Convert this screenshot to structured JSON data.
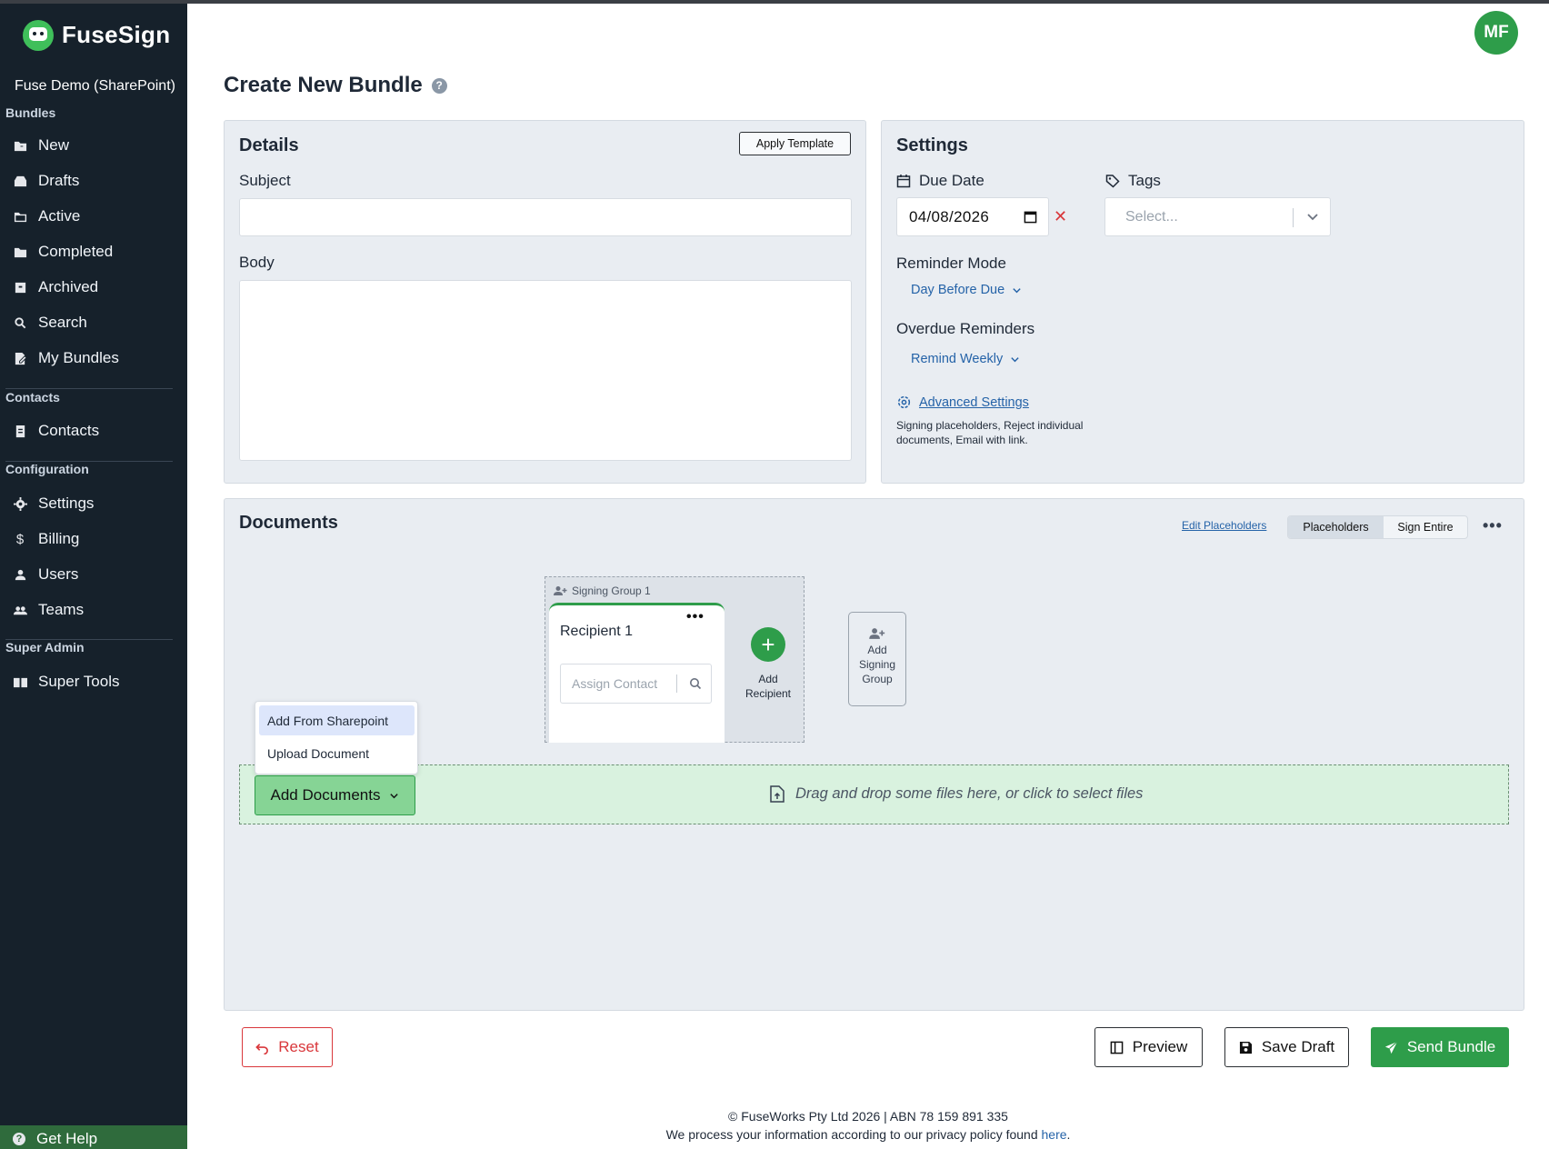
{
  "app": {
    "name": "FuseSign",
    "org": "Fuse Demo (SharePoint)",
    "user_initials": "MF",
    "brand_color": "#2e9d4a"
  },
  "sidebar": {
    "sections": [
      {
        "label": "Bundles",
        "items": [
          {
            "label": "New",
            "icon": "new-bundle-icon"
          },
          {
            "label": "Drafts",
            "icon": "drafts-icon"
          },
          {
            "label": "Active",
            "icon": "active-folder-icon"
          },
          {
            "label": "Completed",
            "icon": "completed-folder-icon"
          },
          {
            "label": "Archived",
            "icon": "archive-icon"
          },
          {
            "label": "Search",
            "icon": "search-icon"
          },
          {
            "label": "My Bundles",
            "icon": "my-bundles-icon"
          }
        ]
      },
      {
        "label": "Contacts",
        "items": [
          {
            "label": "Contacts",
            "icon": "contacts-icon"
          }
        ]
      },
      {
        "label": "Configuration",
        "items": [
          {
            "label": "Settings",
            "icon": "gear-icon"
          },
          {
            "label": "Billing",
            "icon": "dollar-icon"
          },
          {
            "label": "Users",
            "icon": "user-icon"
          },
          {
            "label": "Teams",
            "icon": "team-icon"
          }
        ]
      },
      {
        "label": "Super Admin",
        "items": [
          {
            "label": "Super Tools",
            "icon": "book-icon"
          }
        ]
      }
    ],
    "help": "Get Help"
  },
  "page": {
    "title": "Create New Bundle"
  },
  "details": {
    "title": "Details",
    "apply_template": "Apply Template",
    "subject_label": "Subject",
    "subject_value": "",
    "body_label": "Body",
    "body_value": ""
  },
  "settings": {
    "title": "Settings",
    "due_date_label": "Due Date",
    "due_date_value": "04/08/2026",
    "tags_label": "Tags",
    "tags_placeholder": "Select...",
    "reminder_mode_label": "Reminder Mode",
    "reminder_mode_value": "Day Before Due",
    "overdue_label": "Overdue Reminders",
    "overdue_value": "Remind Weekly",
    "advanced_link": "Advanced Settings",
    "advanced_desc": "Signing placeholders, Reject individual documents, Email with link."
  },
  "documents": {
    "title": "Documents",
    "edit_placeholders": "Edit Placeholders",
    "mode_options": [
      "Placeholders",
      "Sign Entire"
    ],
    "mode_selected": "Placeholders",
    "signing_group": {
      "label": "Signing Group 1",
      "recipient_title": "Recipient 1",
      "assign_placeholder": "Assign Contact",
      "add_recipient": "Add Recipient"
    },
    "add_signing_group": "Add Signing Group",
    "add_documents": "Add Documents",
    "add_menu": [
      "Add From Sharepoint",
      "Upload Document"
    ],
    "dropzone_text": "Drag and drop some files here, or click to select files"
  },
  "actions": {
    "reset": "Reset",
    "preview": "Preview",
    "save_draft": "Save Draft",
    "send": "Send Bundle"
  },
  "footer": {
    "line1": "© FuseWorks Pty Ltd 2026 | ABN 78 159 891 335",
    "line2_prefix": "We process your information according to our privacy policy found ",
    "line2_link": "here",
    "line2_suffix": "."
  }
}
